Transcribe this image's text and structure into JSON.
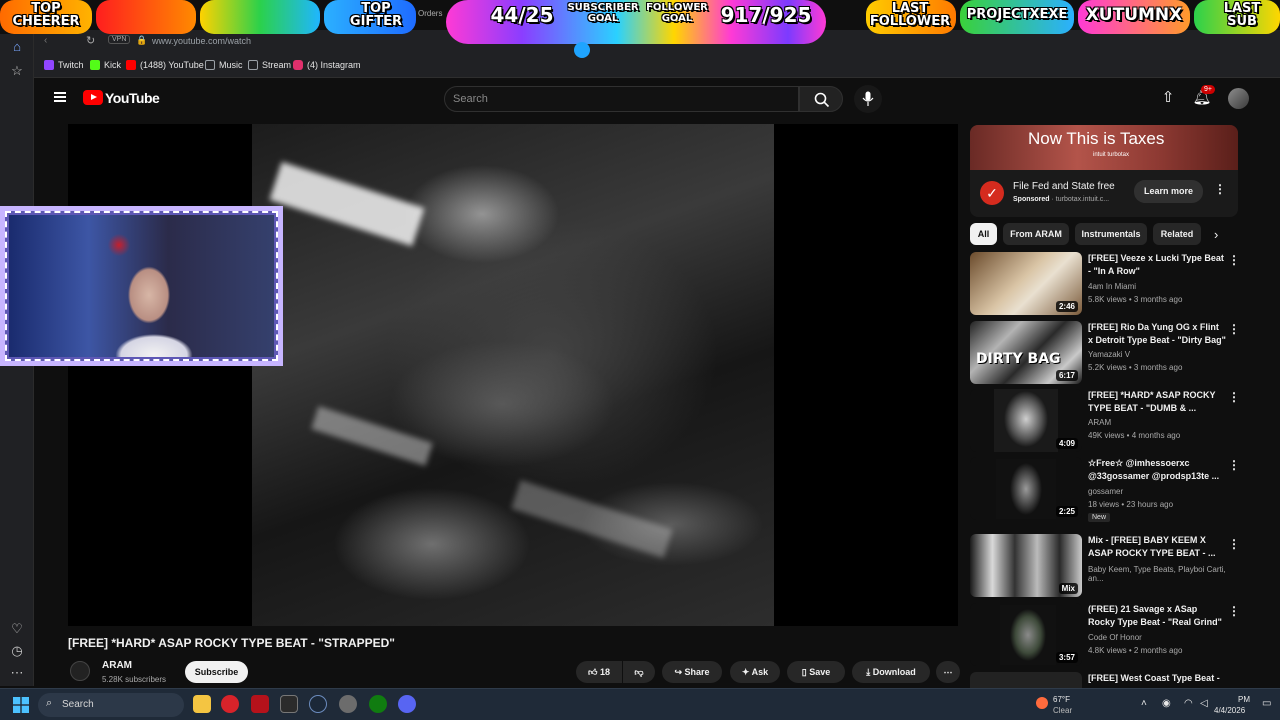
{
  "overlay": {
    "top_cheerer": "TOP\nCHEERER",
    "top_gifter": "TOP\nGIFTER",
    "orders": "Orders",
    "sub_count": "44/25",
    "sub_goal": "SUBSCRIBER\nGOAL",
    "follower_goal": "FOLLOWER\nGOAL",
    "follower_count": "917/925",
    "last_follower_label": "LAST\nFOLLOWER",
    "last_follower_name": "PROJECTXEXE",
    "last_sub_name": "XUTUMNX",
    "last_sub_label": "LAST\nSUB"
  },
  "browser": {
    "vpn": "VPN",
    "url": "www.youtube.com/watch",
    "bookmarks": [
      {
        "label": "Twitch",
        "color": "#9146ff"
      },
      {
        "label": "Kick",
        "color": "#53fc18"
      },
      {
        "label": "(1488) YouTube",
        "color": "#ff0000"
      },
      {
        "label": "Music",
        "color": "#9aa0a6"
      },
      {
        "label": "Stream",
        "color": "#9aa0a6"
      },
      {
        "label": "(4) Instagram",
        "color": "#e1306c"
      }
    ]
  },
  "youtube": {
    "logo_text": "YouTube",
    "search_placeholder": "Search",
    "notif_count": "9+"
  },
  "video": {
    "title": "[FREE] *HARD* ASAP ROCKY TYPE BEAT - \"STRAPPED\"",
    "channel": "ARAM",
    "subscribers": "5.28K subscribers",
    "subscribe_label": "Subscribe",
    "likes": "18",
    "share_label": "Share",
    "ask_label": "Ask",
    "save_label": "Save",
    "download_label": "Download"
  },
  "ad": {
    "banner": "Now This is Taxes",
    "banner_brand": "intuit turbotax",
    "title": "File Fed and State free",
    "sponsored": "Sponsored",
    "domain": "turbotax.intuit.c...",
    "button": "Learn more"
  },
  "chips": [
    "All",
    "From ARAM",
    "Instrumentals",
    "Related"
  ],
  "recommendations": [
    {
      "title": "[FREE] Veeze x Lucki Type Beat - \"In A Row\"",
      "channel": "4am In Miami",
      "meta": "5.8K views • 3 months ago",
      "duration": "2:46"
    },
    {
      "title": "[FREE] Rio Da Yung OG x Flint x Detroit Type Beat - \"Dirty Bag\"",
      "channel": "Yamazaki V",
      "meta": "5.2K views • 3 months ago",
      "duration": "6:17",
      "thumb_text": "DIRTY BAG"
    },
    {
      "title": "[FREE] *HARD* ASAP ROCKY TYPE BEAT - \"DUMB & ...",
      "channel": "ARAM",
      "meta": "49K views • 4 months ago",
      "duration": "4:09"
    },
    {
      "title": "☆Free☆ @imhessoerxc @33gossamer @prodsp13te ...",
      "channel": "gossamer",
      "meta": "18 views • 23 hours ago",
      "duration": "2:25",
      "badge": "New"
    },
    {
      "title": "Mix - [FREE] BABY KEEM X ASAP ROCKY TYPE BEAT - ...",
      "channel": "Baby Keem, Type Beats, Playboi Carti, an...",
      "meta": "",
      "duration": "Mix"
    },
    {
      "title": "(FREE) 21 Savage x ASap Rocky Type Beat - \"Real Grind\"",
      "channel": "Code Of Honor",
      "meta": "4.8K views • 2 months ago",
      "duration": "3:57"
    },
    {
      "title": "[FREE] West Coast Type Beat -",
      "channel": "",
      "meta": "",
      "duration": ""
    }
  ],
  "taskbar": {
    "search": "Search",
    "weather_temp": "67°F",
    "weather_desc": "Clear",
    "time": "PM",
    "date": "4/4/2026"
  }
}
